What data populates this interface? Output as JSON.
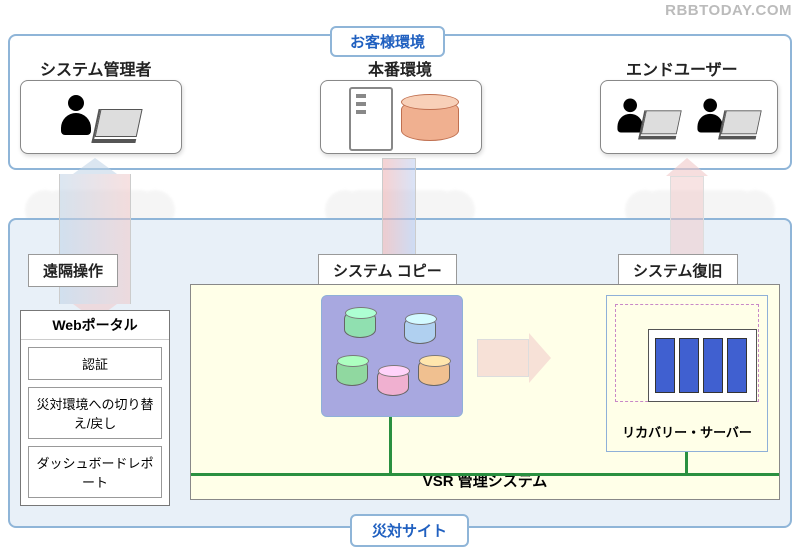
{
  "watermark": "RBBTODAY.COM",
  "customer_env_label": "お客様環境",
  "top": {
    "admin": "システム管理者",
    "prod": "本番環境",
    "enduser": "エンドユーザー"
  },
  "arrows": {
    "remote": "遠隔操作",
    "syscopy": "システム コピー",
    "sysrecover": "システム復旧"
  },
  "portal": {
    "title": "Webポータル",
    "items": [
      "認証",
      "災対環境への切り替え/戻し",
      "ダッシュボードレポート"
    ]
  },
  "vsr_label": "VSR 管理システム",
  "recovery_label": "リカバリー・サーバー",
  "dr_site_label": "災対サイト"
}
